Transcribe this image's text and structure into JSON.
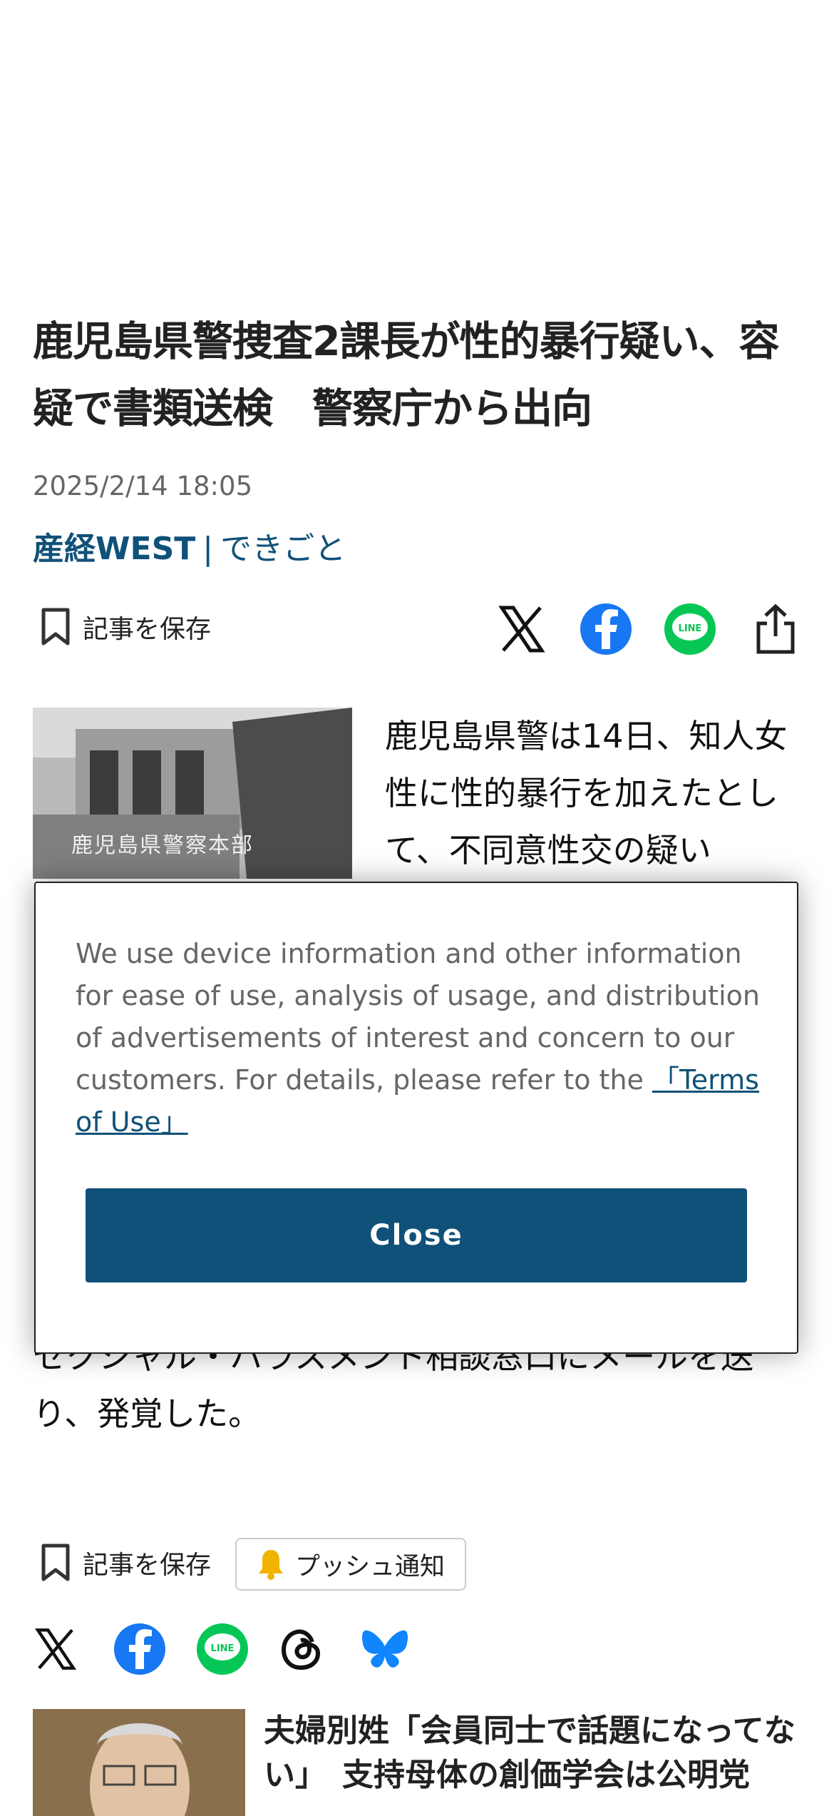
{
  "article": {
    "headline": "鹿児島県警捜査2課長が性的暴行疑い、容疑で書類送検　警察庁から出向",
    "date": "2025/2/14 18:05",
    "publisher": "産経WEST",
    "separator": "|",
    "category": "できごと",
    "lead": "鹿児島県警は14日、知人女性に性的暴行を加えたとして、不同意性交の疑い",
    "continuation": "セクシャル・ハラスメント相談窓口にメールを送り、発覚した。",
    "photo_caption_text": "鹿児島県警察本部"
  },
  "toolbar": {
    "save_label": "記事を保存",
    "push_label": "プッシュ通知"
  },
  "share_icons_top": [
    "x-icon",
    "facebook-icon",
    "line-icon",
    "share-icon"
  ],
  "share_icons_bottom": [
    "x-icon",
    "facebook-icon",
    "line-icon",
    "threads-icon",
    "bluesky-icon"
  ],
  "line_icon_text": "LINE",
  "consent": {
    "message": "We use device information and other information for ease of use, analysis of usage, and distribution of advertisements of interest and concern to our customers. For details, please refer to the",
    "terms_link": "「Terms of Use」",
    "close_label": "Close"
  },
  "related": {
    "title": "夫婦別姓「会員同士で話題になってない」　支持母体の創価学会は公明党"
  },
  "colors": {
    "brand": "#0f5178",
    "facebook": "#1877f2",
    "line": "#06c755",
    "bluesky": "#1185fe",
    "bell": "#f0b400"
  }
}
